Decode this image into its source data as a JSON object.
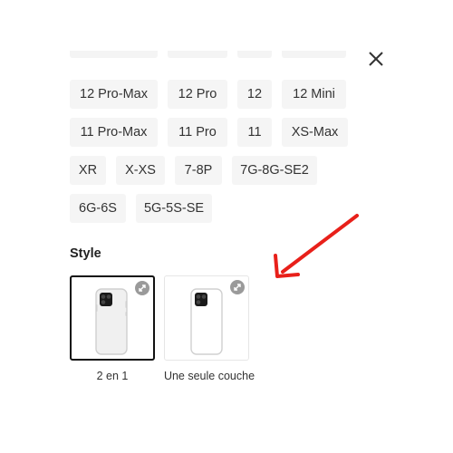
{
  "close": {
    "icon": "close-icon"
  },
  "models": {
    "rows": [
      [
        "12 Pro-Max",
        "12 Pro",
        "12",
        "12 Mini"
      ],
      [
        "11 Pro-Max",
        "11 Pro",
        "11",
        "XS-Max"
      ],
      [
        "XR",
        "X-XS",
        "7-8P",
        "7G-8G-SE2"
      ],
      [
        "6G-6S",
        "5G-5S-SE"
      ]
    ]
  },
  "style": {
    "label": "Style",
    "options": [
      {
        "caption": "2 en 1",
        "selected": true,
        "badge_icon": "expand-icon"
      },
      {
        "caption": "Une seule couche",
        "selected": false,
        "badge_icon": "expand-icon"
      }
    ]
  },
  "colors": {
    "chip_bg": "#f5f5f5",
    "selected_border": "#111111",
    "annotation_arrow": "#e8201a"
  }
}
